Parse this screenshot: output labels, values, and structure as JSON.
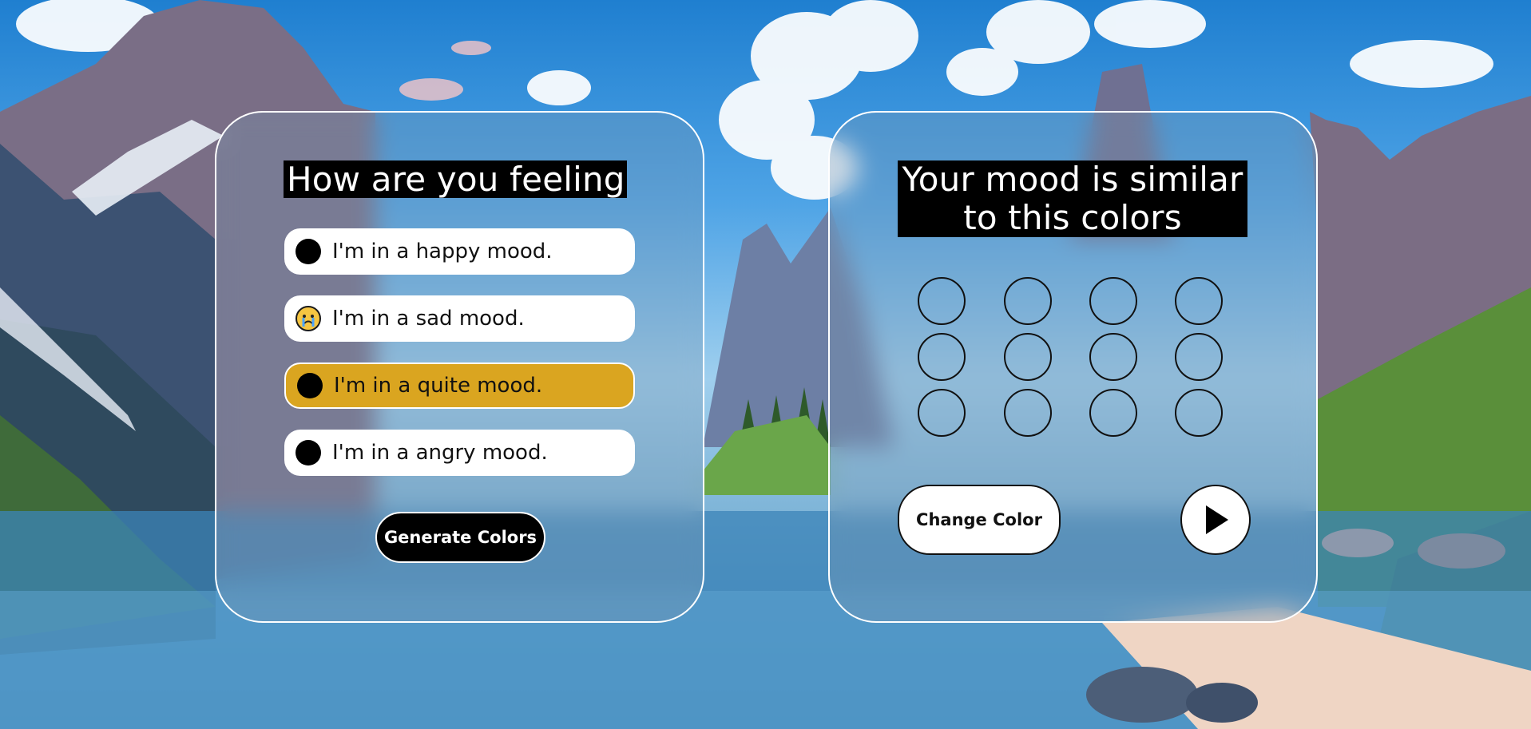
{
  "left_panel": {
    "title": "How are you feeling?",
    "moods": [
      {
        "label": "I'm in a happy mood.",
        "icon": "black-circle",
        "selected": false
      },
      {
        "label": "I'm in a sad mood.",
        "icon": "crying-face-emoji",
        "selected": false
      },
      {
        "label": "I'm in a quite mood.",
        "icon": "black-circle",
        "selected": true
      },
      {
        "label": "I'm in a angry mood.",
        "icon": "black-circle",
        "selected": false
      }
    ],
    "selected_color": "#daa520",
    "generate_label": "Generate Colors"
  },
  "right_panel": {
    "title_line1": "Your mood is similar",
    "title_line2": "to this colors",
    "swatch_grid": {
      "rows": 3,
      "columns": 4,
      "filled": false
    },
    "change_color_label": "Change Color",
    "play_icon": "play-icon"
  },
  "background": {
    "description_colors": [
      "#1f7fd0",
      "#9fcfee",
      "#3f85b8"
    ]
  }
}
